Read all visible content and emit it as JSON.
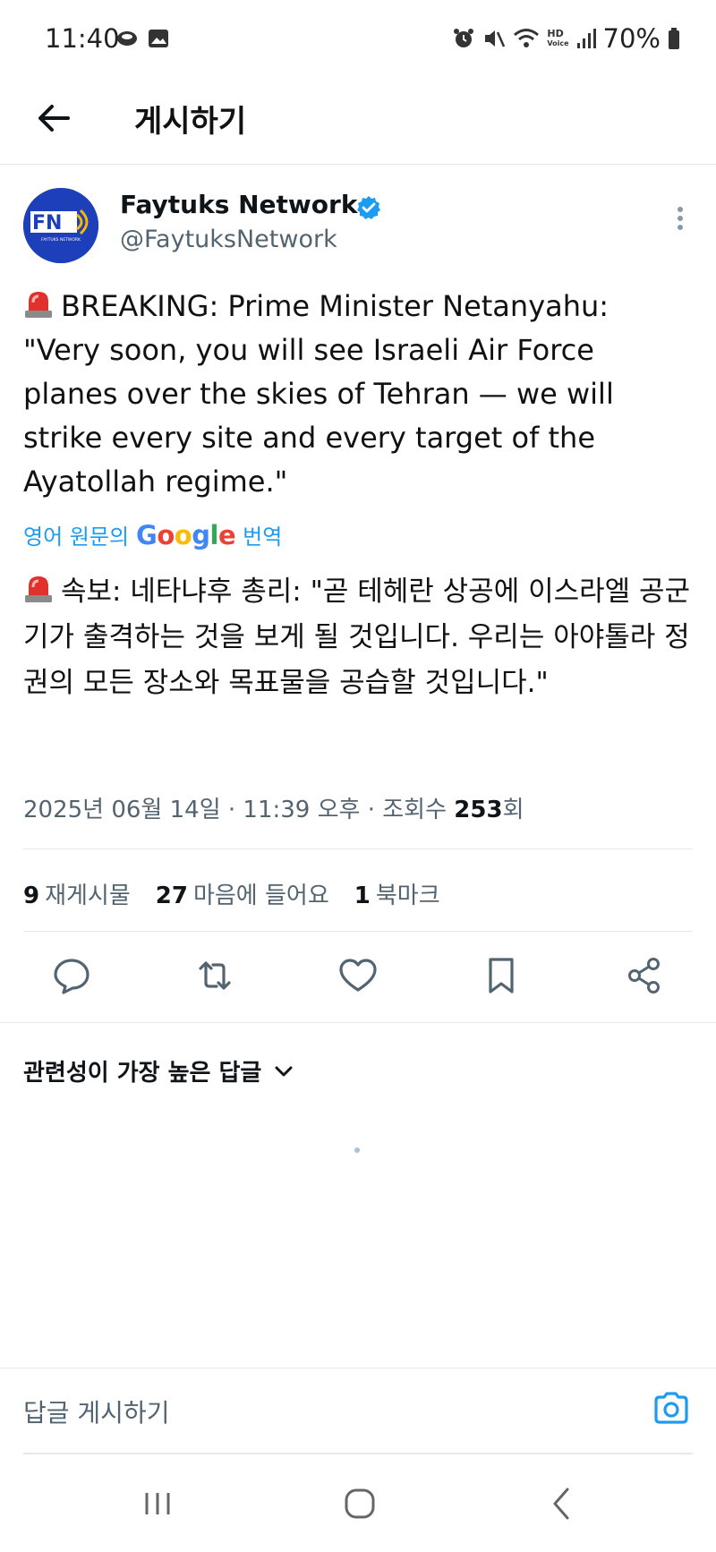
{
  "status_bar": {
    "time": "11:40",
    "battery": "70%",
    "hd_label": "HD",
    "voice_label": "Voice"
  },
  "header": {
    "title": "게시하기"
  },
  "tweet": {
    "author": {
      "name": "Faytuks Network",
      "handle": "@FaytuksNetwork",
      "avatar_text": "FN",
      "avatar_subtext": "FAYTUKS NETWORK"
    },
    "text_en": "BREAKING: Prime Minister Netanyahu: \"Very soon, you will see Israeli Air Force planes over the skies of Tehran — we will strike every site and every target of the Ayatollah regime.\"",
    "translate": {
      "prefix": "영어 원문의",
      "brand": "Google",
      "suffix": "번역"
    },
    "text_ko": "속보: 네타냐후 총리: \"곧 테헤란 상공에 이스라엘 공군기가 출격하는 것을 보게 될 것입니다. 우리는 아야톨라 정권의 모든 장소와 목표물을 공습할 것입니다.\"",
    "meta": {
      "datetime": "2025년 06월 14일 · 11:39 오후 · 조회수",
      "views": "253",
      "views_suffix": "회"
    },
    "stats": {
      "reposts_count": "9",
      "reposts_label": "재게시물",
      "likes_count": "27",
      "likes_label": "마음에 들어요",
      "bookmarks_count": "1",
      "bookmarks_label": "북마크"
    }
  },
  "replies": {
    "sort_label": "관련성이 가장 높은 답글"
  },
  "reply_bar": {
    "placeholder": "답글 게시하기"
  },
  "colors": {
    "accent": "#1d9bf0",
    "siren_red": "#e0312d",
    "avatar_bg": "#1d3fb9",
    "secondary_text": "#536471"
  }
}
